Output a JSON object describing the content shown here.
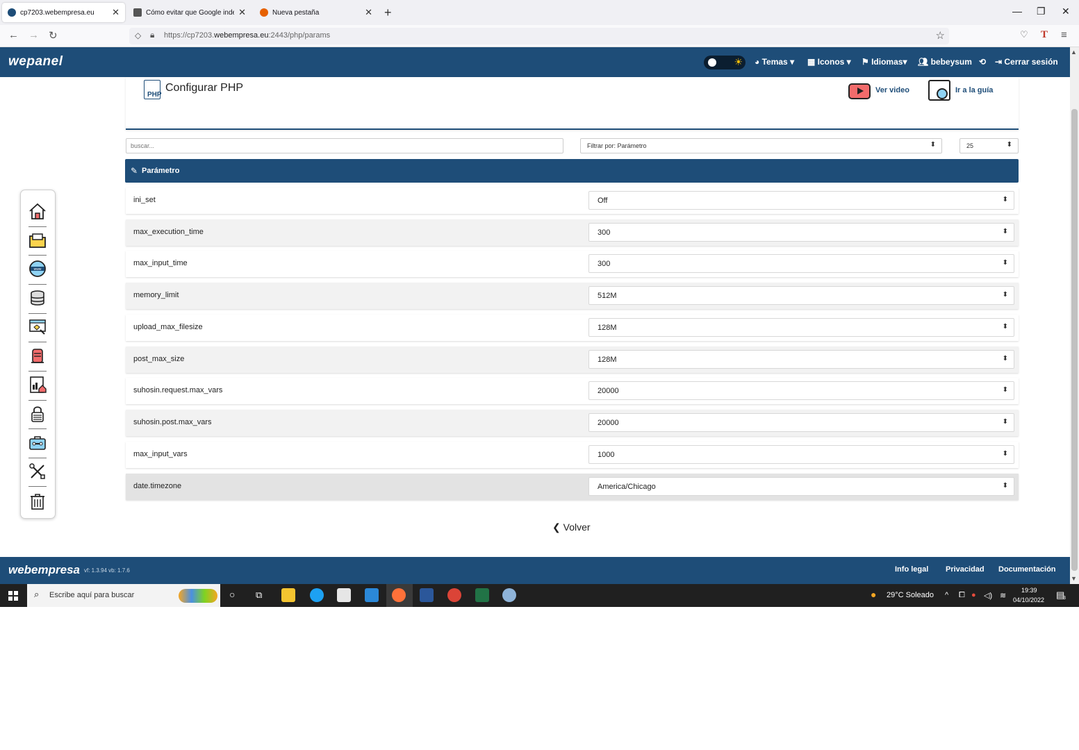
{
  "browser": {
    "tabs": [
      {
        "title": "cp7203.webempresa.eu",
        "active": true
      },
      {
        "title": "Cómo evitar que Google indexe",
        "active": false
      },
      {
        "title": "Nueva pestaña",
        "active": false
      }
    ],
    "new_tab": "+",
    "url_prefix": "https://cp7203.",
    "url_host": "webempresa.eu",
    "url_suffix": ":2443/php/params"
  },
  "header": {
    "logo": "wepanel",
    "menu": {
      "temas": "Temas",
      "iconos": "Iconos",
      "idiomas": "Idiomas",
      "user": "bebeysum",
      "logout": "Cerrar sesión"
    }
  },
  "page": {
    "title": "Configurar PHP",
    "video_link": "Ver video",
    "guide_link": "Ir a la guía",
    "php_icon_text": "PHP"
  },
  "filters": {
    "search_placeholder": "buscar...",
    "filter_by": "Filtrar por: Parámetro",
    "per_page": "25"
  },
  "table": {
    "header": "Parámetro",
    "rows": [
      {
        "name": "ini_set",
        "value": "Off"
      },
      {
        "name": "max_execution_time",
        "value": "300"
      },
      {
        "name": "max_input_time",
        "value": "300"
      },
      {
        "name": "memory_limit",
        "value": "512M"
      },
      {
        "name": "upload_max_filesize",
        "value": "128M"
      },
      {
        "name": "post_max_size",
        "value": "128M"
      },
      {
        "name": "suhosin.request.max_vars",
        "value": "20000"
      },
      {
        "name": "suhosin.post.max_vars",
        "value": "20000"
      },
      {
        "name": "max_input_vars",
        "value": "1000"
      },
      {
        "name": "date.timezone",
        "value": "America/Chicago"
      }
    ]
  },
  "back_label": "Volver",
  "footer": {
    "logo": "webempresa",
    "version": "vf: 1.3.94 vb: 1.7.6",
    "links": [
      "Info legal",
      "Privacidad",
      "Documentación"
    ]
  },
  "taskbar": {
    "search_placeholder": "Escribe aquí para buscar",
    "weather": "29°C  Soleado",
    "time": "19:39",
    "date": "04/10/2022",
    "notifications": "3"
  },
  "colors": {
    "primary": "#1e4d78",
    "row_alt": "#f2f2f2",
    "row_highlight": "#e3e3e3"
  }
}
